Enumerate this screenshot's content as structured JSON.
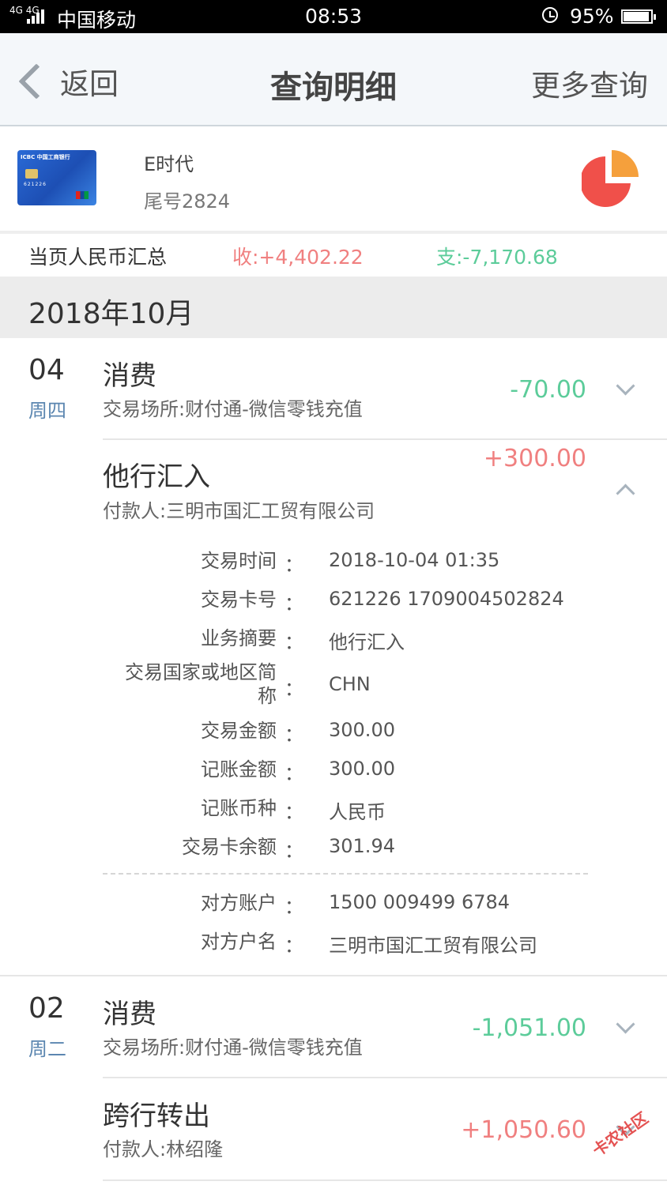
{
  "status": {
    "signal": "4G 4G",
    "carrier": "中国移动",
    "time": "08:53",
    "battery": "95%"
  },
  "nav": {
    "back": "返回",
    "title": "查询明细",
    "more": "更多查询"
  },
  "card": {
    "name": "E时代",
    "tail": "尾号2824",
    "art": {
      "bank": "ICBC 中国工商银行",
      "number": "621226"
    }
  },
  "summary": {
    "label": "当页人民币汇总",
    "income": "收:+4,402.22",
    "expense": "支:-7,170.68"
  },
  "month": "2018年10月",
  "transactions": [
    {
      "day": "04",
      "weekday": "周四",
      "title": "消费",
      "sub": "交易场所:财付通-微信零钱充值",
      "amount": "-70.00"
    },
    {
      "title": "他行汇入",
      "sub": "付款人:三明市国汇工贸有限公司",
      "amount": "+300.00",
      "details": [
        {
          "label": "交易时间",
          "value": "2018-10-04 01:35"
        },
        {
          "label": "交易卡号",
          "value": "621226 1709004502824"
        },
        {
          "label": "业务摘要",
          "value": "他行汇入"
        },
        {
          "label": "交易国家或地区简称",
          "value": "CHN"
        },
        {
          "label": "交易金额",
          "value": "300.00"
        },
        {
          "label": "记账金额",
          "value": "300.00"
        },
        {
          "label": "记账币种",
          "value": "人民币"
        },
        {
          "label": "交易卡余额",
          "value": "301.94"
        }
      ],
      "counterparty": [
        {
          "label": "对方账户",
          "value": "1500 009499 6784"
        },
        {
          "label": "对方户名",
          "value": "三明市国汇工贸有限公司"
        }
      ]
    },
    {
      "day": "02",
      "weekday": "周二",
      "title": "消费",
      "sub": "交易场所:财付通-微信零钱充值",
      "amount": "-1,051.00"
    },
    {
      "title": "跨行转出",
      "sub": "付款人:林绍隆",
      "amount": "+1,050.60"
    }
  ],
  "colon": "：",
  "watermark": "卡农社区",
  "colors": {
    "income": "#f08080",
    "expense": "#5ccc9a",
    "weekday": "#5b86b0",
    "pie_orange": "#f5a03c",
    "pie_red": "#f0504a"
  }
}
